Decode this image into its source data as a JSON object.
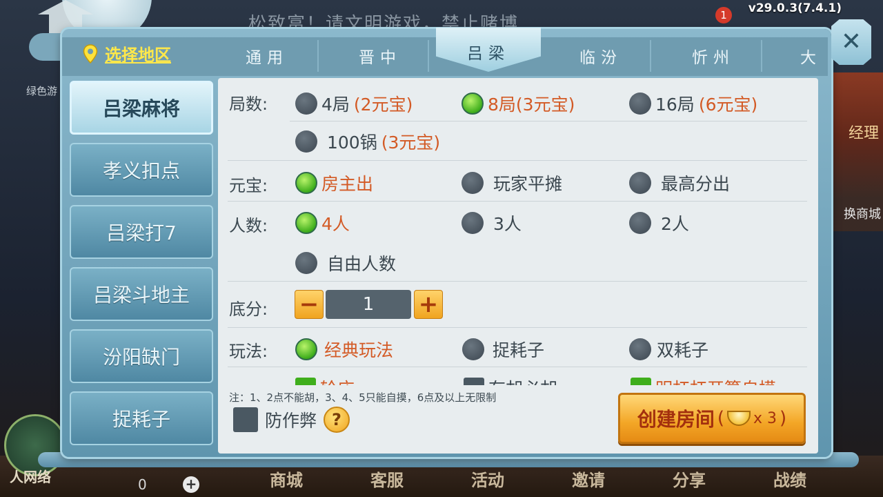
{
  "version": "v29.0.3(7.4.1)",
  "background": {
    "notice": "松致富！请文明游戏，禁止赌博",
    "left_label": "绿色游",
    "right_label_top": "经理",
    "right_label_bottom": "换商城",
    "notification_count": "1",
    "bottom_nav": [
      "商城",
      "客服",
      "活动",
      "邀请",
      "分享",
      "战绩"
    ],
    "bottom_logo_text": "人网络",
    "bottom_counter": "0"
  },
  "region": {
    "label": "选择地区",
    "tabs": [
      "通用",
      "晋中",
      "吕梁",
      "临汾",
      "忻州",
      "大"
    ],
    "active_tab": "吕梁"
  },
  "side_menu": {
    "items": [
      "吕梁麻将",
      "孝义扣点",
      "吕梁打7",
      "吕梁斗地主",
      "汾阳缺门",
      "捉耗子"
    ],
    "active": "吕梁麻将"
  },
  "form": {
    "rounds": {
      "label": "局数:",
      "options": [
        {
          "text": "4局",
          "sub": "(2元宝)",
          "selected": false
        },
        {
          "text": "8局(3元宝)",
          "sub": "",
          "selected": true
        },
        {
          "text": "16局",
          "sub": "(6元宝)",
          "selected": false
        },
        {
          "text": "100锅",
          "sub": "(3元宝)",
          "selected": false
        }
      ]
    },
    "payment": {
      "label": "元宝:",
      "options": [
        {
          "text": "房主出",
          "selected": true
        },
        {
          "text": "玩家平摊",
          "selected": false
        },
        {
          "text": "最高分出",
          "selected": false
        }
      ]
    },
    "players": {
      "label": "人数:",
      "options": [
        {
          "text": "4人",
          "selected": true
        },
        {
          "text": "3人",
          "selected": false
        },
        {
          "text": "2人",
          "selected": false
        },
        {
          "text": "自由人数",
          "selected": false
        }
      ]
    },
    "base_score": {
      "label": "底分:",
      "value": "1",
      "minus": "−",
      "plus": "+"
    },
    "play_style": {
      "label": "玩法:",
      "options": [
        {
          "text": "经典玩法",
          "selected": true
        },
        {
          "text": "捉耗子",
          "selected": false
        },
        {
          "text": "双耗子",
          "selected": false
        }
      ]
    },
    "partial_row": [
      "轮庄",
      "有胡必胡",
      "明杠杠开算自摸"
    ],
    "note": "注：1、2点不能胡，3、4、5只能自摸，6点及以上无限制",
    "anti_cheat": "防作弊",
    "help": "?",
    "create": {
      "label": "创建房间",
      "open": "(",
      "cost": "x 3",
      "close": ")"
    }
  },
  "colors": {
    "selected_text": "#d35a25",
    "region_label": "#ffe84a",
    "dialog": "#6f9cb0"
  }
}
